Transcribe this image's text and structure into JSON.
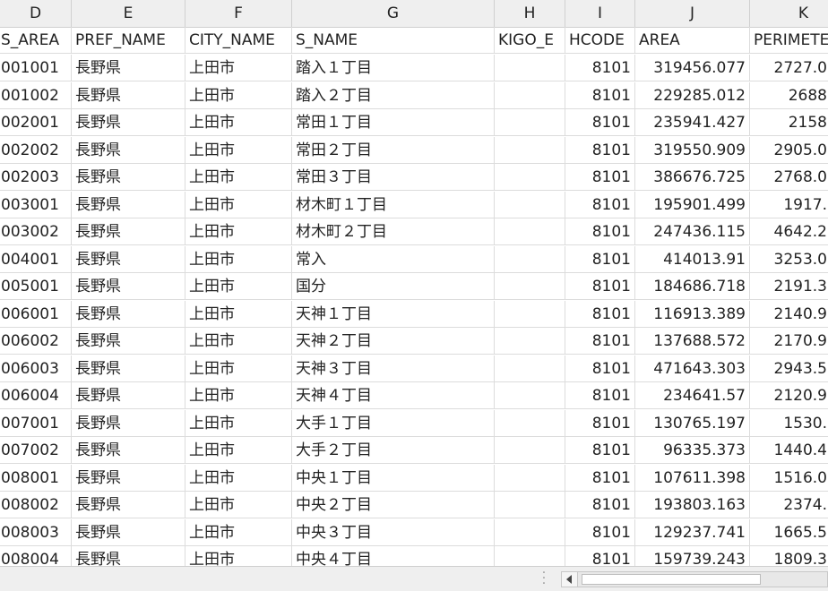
{
  "columns": [
    {
      "letter": "D",
      "header": "S_AREA"
    },
    {
      "letter": "E",
      "header": "PREF_NAME"
    },
    {
      "letter": "F",
      "header": "CITY_NAME"
    },
    {
      "letter": "G",
      "header": "S_NAME"
    },
    {
      "letter": "H",
      "header": "KIGO_E"
    },
    {
      "letter": "I",
      "header": "HCODE"
    },
    {
      "letter": "J",
      "header": "AREA"
    },
    {
      "letter": "K",
      "header": "PERIMETE"
    }
  ],
  "rows": [
    [
      "001001",
      "長野県",
      "上田市",
      "踏入１丁目",
      "",
      "8101",
      "319456.077",
      "2727.0"
    ],
    [
      "001002",
      "長野県",
      "上田市",
      "踏入２丁目",
      "",
      "8101",
      "229285.012",
      "2688"
    ],
    [
      "002001",
      "長野県",
      "上田市",
      "常田１丁目",
      "",
      "8101",
      "235941.427",
      "2158"
    ],
    [
      "002002",
      "長野県",
      "上田市",
      "常田２丁目",
      "",
      "8101",
      "319550.909",
      "2905.0"
    ],
    [
      "002003",
      "長野県",
      "上田市",
      "常田３丁目",
      "",
      "8101",
      "386676.725",
      "2768.0"
    ],
    [
      "003001",
      "長野県",
      "上田市",
      "材木町１丁目",
      "",
      "8101",
      "195901.499",
      "1917."
    ],
    [
      "003002",
      "長野県",
      "上田市",
      "材木町２丁目",
      "",
      "8101",
      "247436.115",
      "4642.2"
    ],
    [
      "004001",
      "長野県",
      "上田市",
      "常入",
      "",
      "8101",
      "414013.91",
      "3253.0"
    ],
    [
      "005001",
      "長野県",
      "上田市",
      "国分",
      "",
      "8101",
      "184686.718",
      "2191.3"
    ],
    [
      "006001",
      "長野県",
      "上田市",
      "天神１丁目",
      "",
      "8101",
      "116913.389",
      "2140.9"
    ],
    [
      "006002",
      "長野県",
      "上田市",
      "天神２丁目",
      "",
      "8101",
      "137688.572",
      "2170.9"
    ],
    [
      "006003",
      "長野県",
      "上田市",
      "天神３丁目",
      "",
      "8101",
      "471643.303",
      "2943.5"
    ],
    [
      "006004",
      "長野県",
      "上田市",
      "天神４丁目",
      "",
      "8101",
      "234641.57",
      "2120.9"
    ],
    [
      "007001",
      "長野県",
      "上田市",
      "大手１丁目",
      "",
      "8101",
      "130765.197",
      "1530."
    ],
    [
      "007002",
      "長野県",
      "上田市",
      "大手２丁目",
      "",
      "8101",
      "96335.373",
      "1440.4"
    ],
    [
      "008001",
      "長野県",
      "上田市",
      "中央１丁目",
      "",
      "8101",
      "107611.398",
      "1516.0"
    ],
    [
      "008002",
      "長野県",
      "上田市",
      "中央２丁目",
      "",
      "8101",
      "193803.163",
      "2374."
    ],
    [
      "008003",
      "長野県",
      "上田市",
      "中央３丁目",
      "",
      "8101",
      "129237.741",
      "1665.5"
    ],
    [
      "008004",
      "長野県",
      "上田市",
      "中央４丁目",
      "",
      "8101",
      "159739.243",
      "1809.3"
    ]
  ]
}
